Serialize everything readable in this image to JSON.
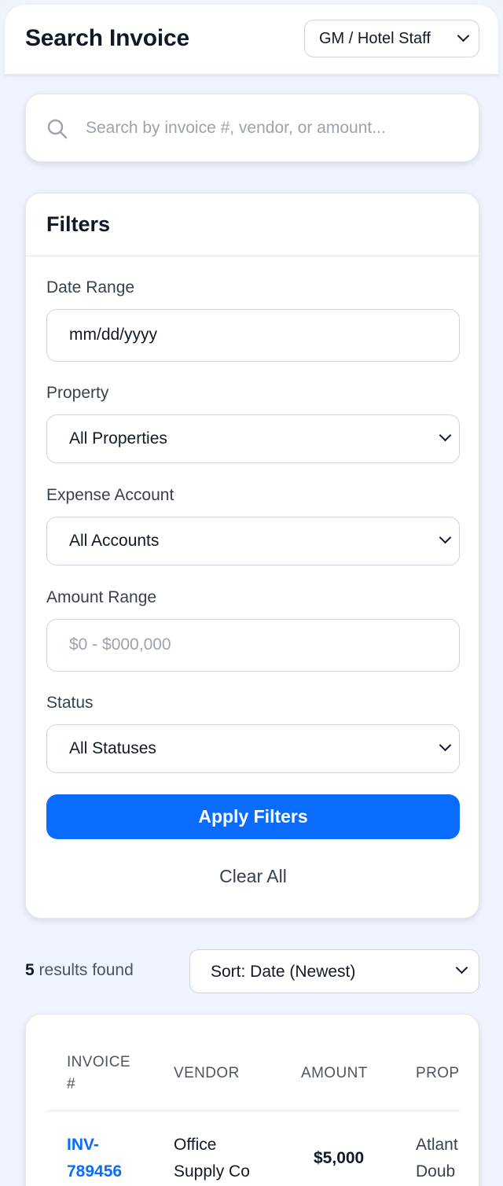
{
  "header": {
    "title": "Search Invoice",
    "role_select": "GM / Hotel Staff"
  },
  "search": {
    "placeholder": "Search by invoice #, vendor, or amount..."
  },
  "filters": {
    "title": "Filters",
    "date_range": {
      "label": "Date Range",
      "value": "mm/dd/yyyy"
    },
    "property": {
      "label": "Property",
      "value": "All Properties"
    },
    "expense_account": {
      "label": "Expense Account",
      "value": "All Accounts"
    },
    "amount_range": {
      "label": "Amount Range",
      "placeholder": "$0 - $000,000"
    },
    "status": {
      "label": "Status",
      "value": "All Statuses"
    },
    "apply_label": "Apply Filters",
    "clear_label": "Clear All"
  },
  "results": {
    "count": "5",
    "count_suffix": " results found",
    "sort": "Sort: Date (Newest)"
  },
  "table": {
    "columns": {
      "invoice_line1": "INVOICE",
      "invoice_line2": "#",
      "vendor": "VENDOR",
      "amount": "AMOUNT",
      "property": "PROP"
    },
    "rows": [
      {
        "invoice_line1": "INV-",
        "invoice_line2": "789456",
        "vendor_line1": "Office",
        "vendor_line2": "Supply Co",
        "amount": "$5,000",
        "property_line1": "Atlant",
        "property_line2": "Doub"
      }
    ]
  },
  "colors": {
    "accent": "#0a6cff",
    "background": "#eff3fd"
  }
}
